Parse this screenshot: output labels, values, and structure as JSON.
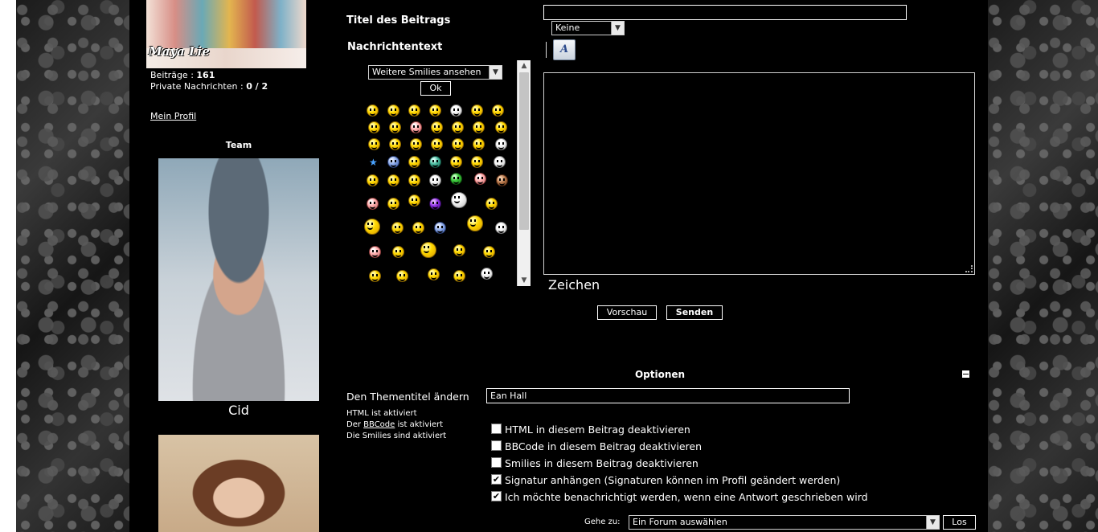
{
  "sidebar": {
    "signature": "Maya Lie",
    "posts_label": "Beiträge :",
    "posts_value": "161",
    "pm_label": "Private Nachrichten :",
    "pm_value": "0 / 2",
    "profile_link": "Mein Profil",
    "team_title": "Team",
    "team_members": [
      "Cid"
    ]
  },
  "form": {
    "title_label": "Titel des Beitrags",
    "title_value": "",
    "icon_select": "Keine",
    "message_label": "Nachrichtentext",
    "smilies_select": "Weitere Smilies ansehen",
    "ok_button": "Ok",
    "char_label": "Zeichen",
    "preview_button": "Vorschau",
    "send_button": "Senden"
  },
  "options": {
    "title": "Optionen",
    "topic_title_label": "Den Thementitel ändern",
    "topic_title_value": "Ean Hall",
    "status_html": "HTML ist aktiviert",
    "status_bbcode_prefix": "Der",
    "status_bbcode_link": "BBCode",
    "status_bbcode_suffix": "ist aktiviert",
    "status_smilies": "Die Smilies sind aktiviert",
    "checkboxes": [
      {
        "label": "HTML in diesem Beitrag deaktivieren",
        "checked": false
      },
      {
        "label": "BBCode in diesem Beitrag deaktivieren",
        "checked": false
      },
      {
        "label": "Smilies in diesem Beitrag deaktivieren",
        "checked": false
      },
      {
        "label": "Signatur anhängen (Signaturen können im Profil geändert werden)",
        "checked": true
      },
      {
        "label": "Ich möchte benachrichtigt werden, wenn eine Antwort geschrieben wird",
        "checked": true
      }
    ]
  },
  "jump": {
    "label": "Gehe zu:",
    "select": "Ein Forum auswählen",
    "button": "Los"
  },
  "icons": [
    "format-icon",
    "minus-icon",
    "chevron-down-icon",
    "smiley-icon",
    "star-icon"
  ],
  "colors": {
    "background": "#000000",
    "text": "#ffffff",
    "page": "#ffffff"
  }
}
